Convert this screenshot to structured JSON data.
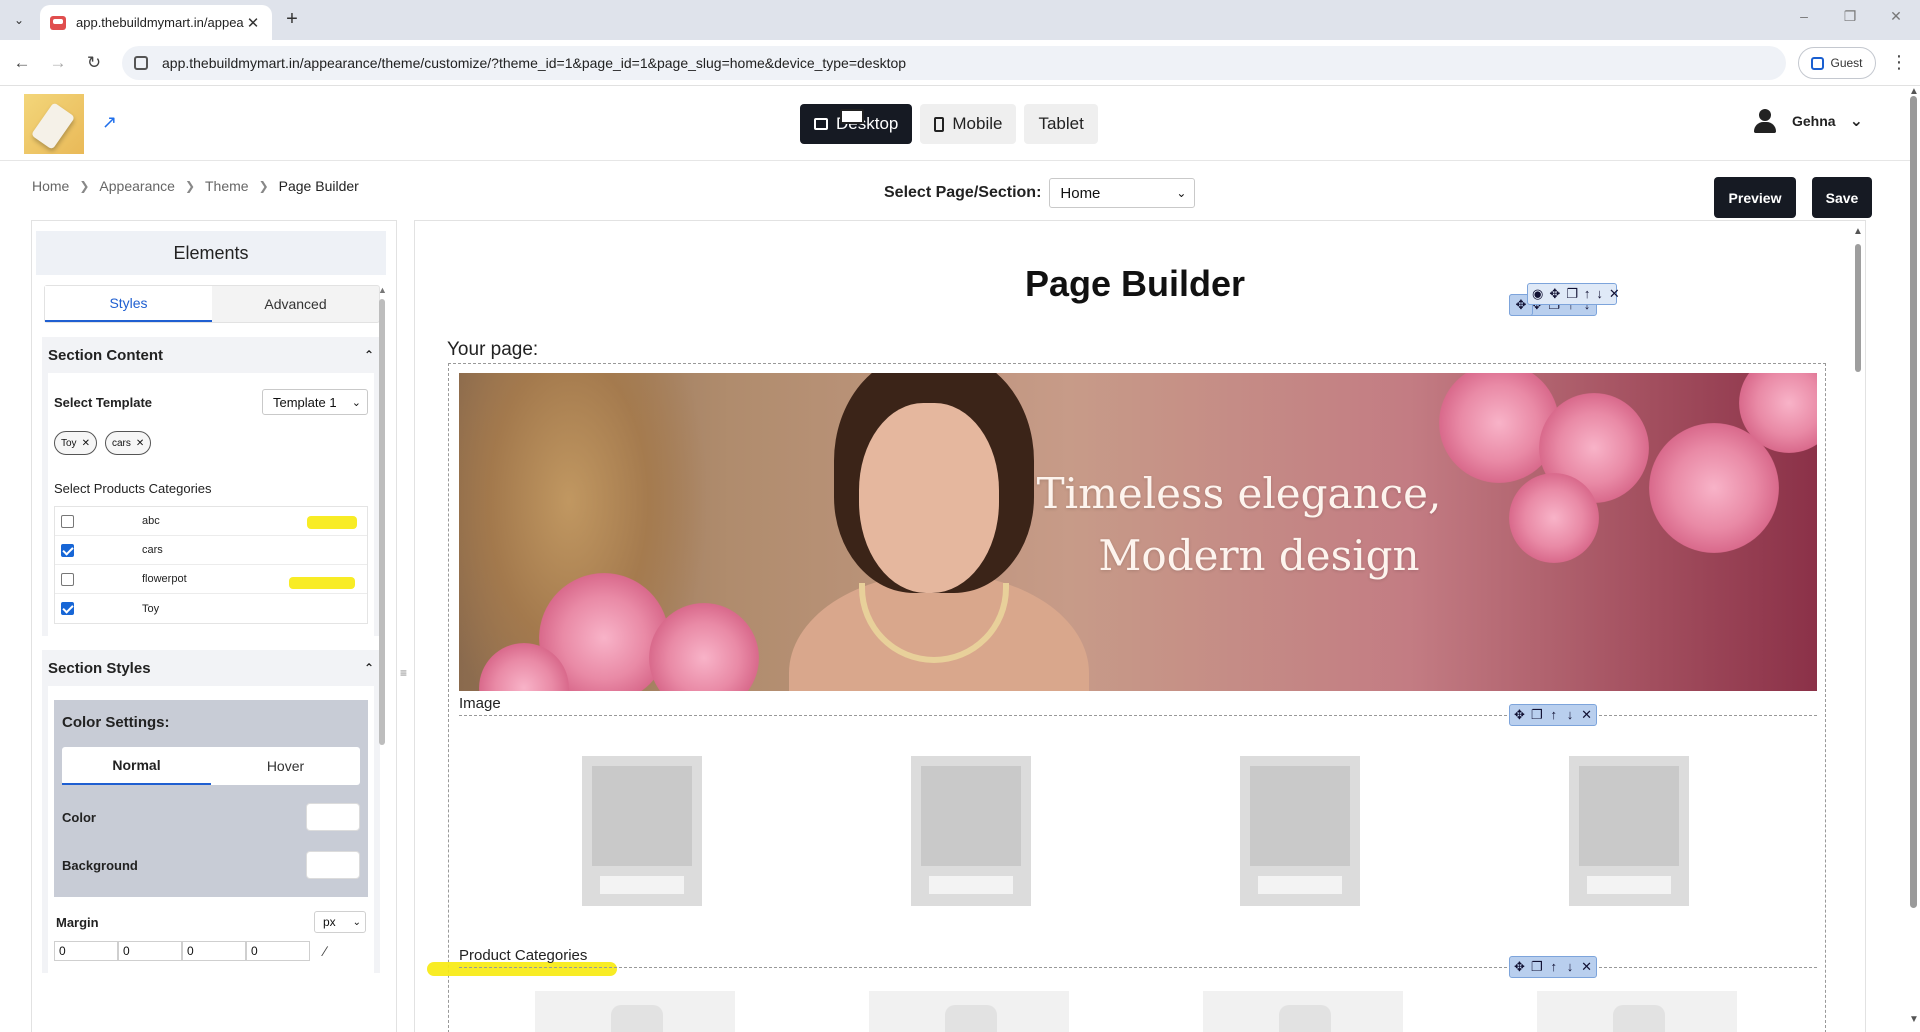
{
  "browser": {
    "tab_title": "app.thebuildmymart.in/appeara",
    "url": "app.thebuildmymart.in/appearance/theme/customize/?theme_id=1&page_id=1&page_slug=home&device_type=desktop",
    "profile_label": "Guest"
  },
  "header": {
    "devices": [
      {
        "label": "Desktop",
        "icon": "desktop-icon",
        "active": true
      },
      {
        "label": "Mobile",
        "icon": "mobile-icon",
        "active": false
      },
      {
        "label": "Tablet",
        "icon": "tablet-icon",
        "active": false
      }
    ],
    "user_name": "Gehna"
  },
  "breadcrumb": [
    "Home",
    "Appearance",
    "Theme",
    "Page Builder"
  ],
  "page_select": {
    "label": "Select Page/Section:",
    "value": "Home"
  },
  "actions": {
    "preview_label": "Preview",
    "save_label": "Save"
  },
  "left_panel": {
    "title": "Elements",
    "tabs": [
      "Styles",
      "Advanced"
    ],
    "section_content": {
      "title": "Section Content",
      "template_label": "Select Template",
      "template_value": "Template 1",
      "chips": [
        "Toy",
        "cars"
      ],
      "categories_label": "Select Products Categories",
      "categories": [
        {
          "name": "abc",
          "checked": false
        },
        {
          "name": "cars",
          "checked": true
        },
        {
          "name": "flowerpot",
          "checked": false
        },
        {
          "name": "Toy",
          "checked": true
        }
      ]
    },
    "section_styles": {
      "title": "Section Styles",
      "color_settings_title": "Color Settings:",
      "tabs": [
        "Normal",
        "Hover"
      ],
      "color_label": "Color",
      "background_label": "Background",
      "margin_label": "Margin",
      "margin_unit": "px",
      "margin_values": [
        "0",
        "0",
        "0",
        "0"
      ]
    }
  },
  "canvas": {
    "title": "Page Builder",
    "your_page_label": "Your page:",
    "hero_line1": "Timeless elegance,",
    "hero_line2": "Modern design",
    "image_label": "Image",
    "categories_section_label": "Product Categories"
  },
  "colors": {
    "primary_dark": "#161a23",
    "accent_blue": "#1f5fd1",
    "highlight_yellow": "#f7ea12"
  }
}
